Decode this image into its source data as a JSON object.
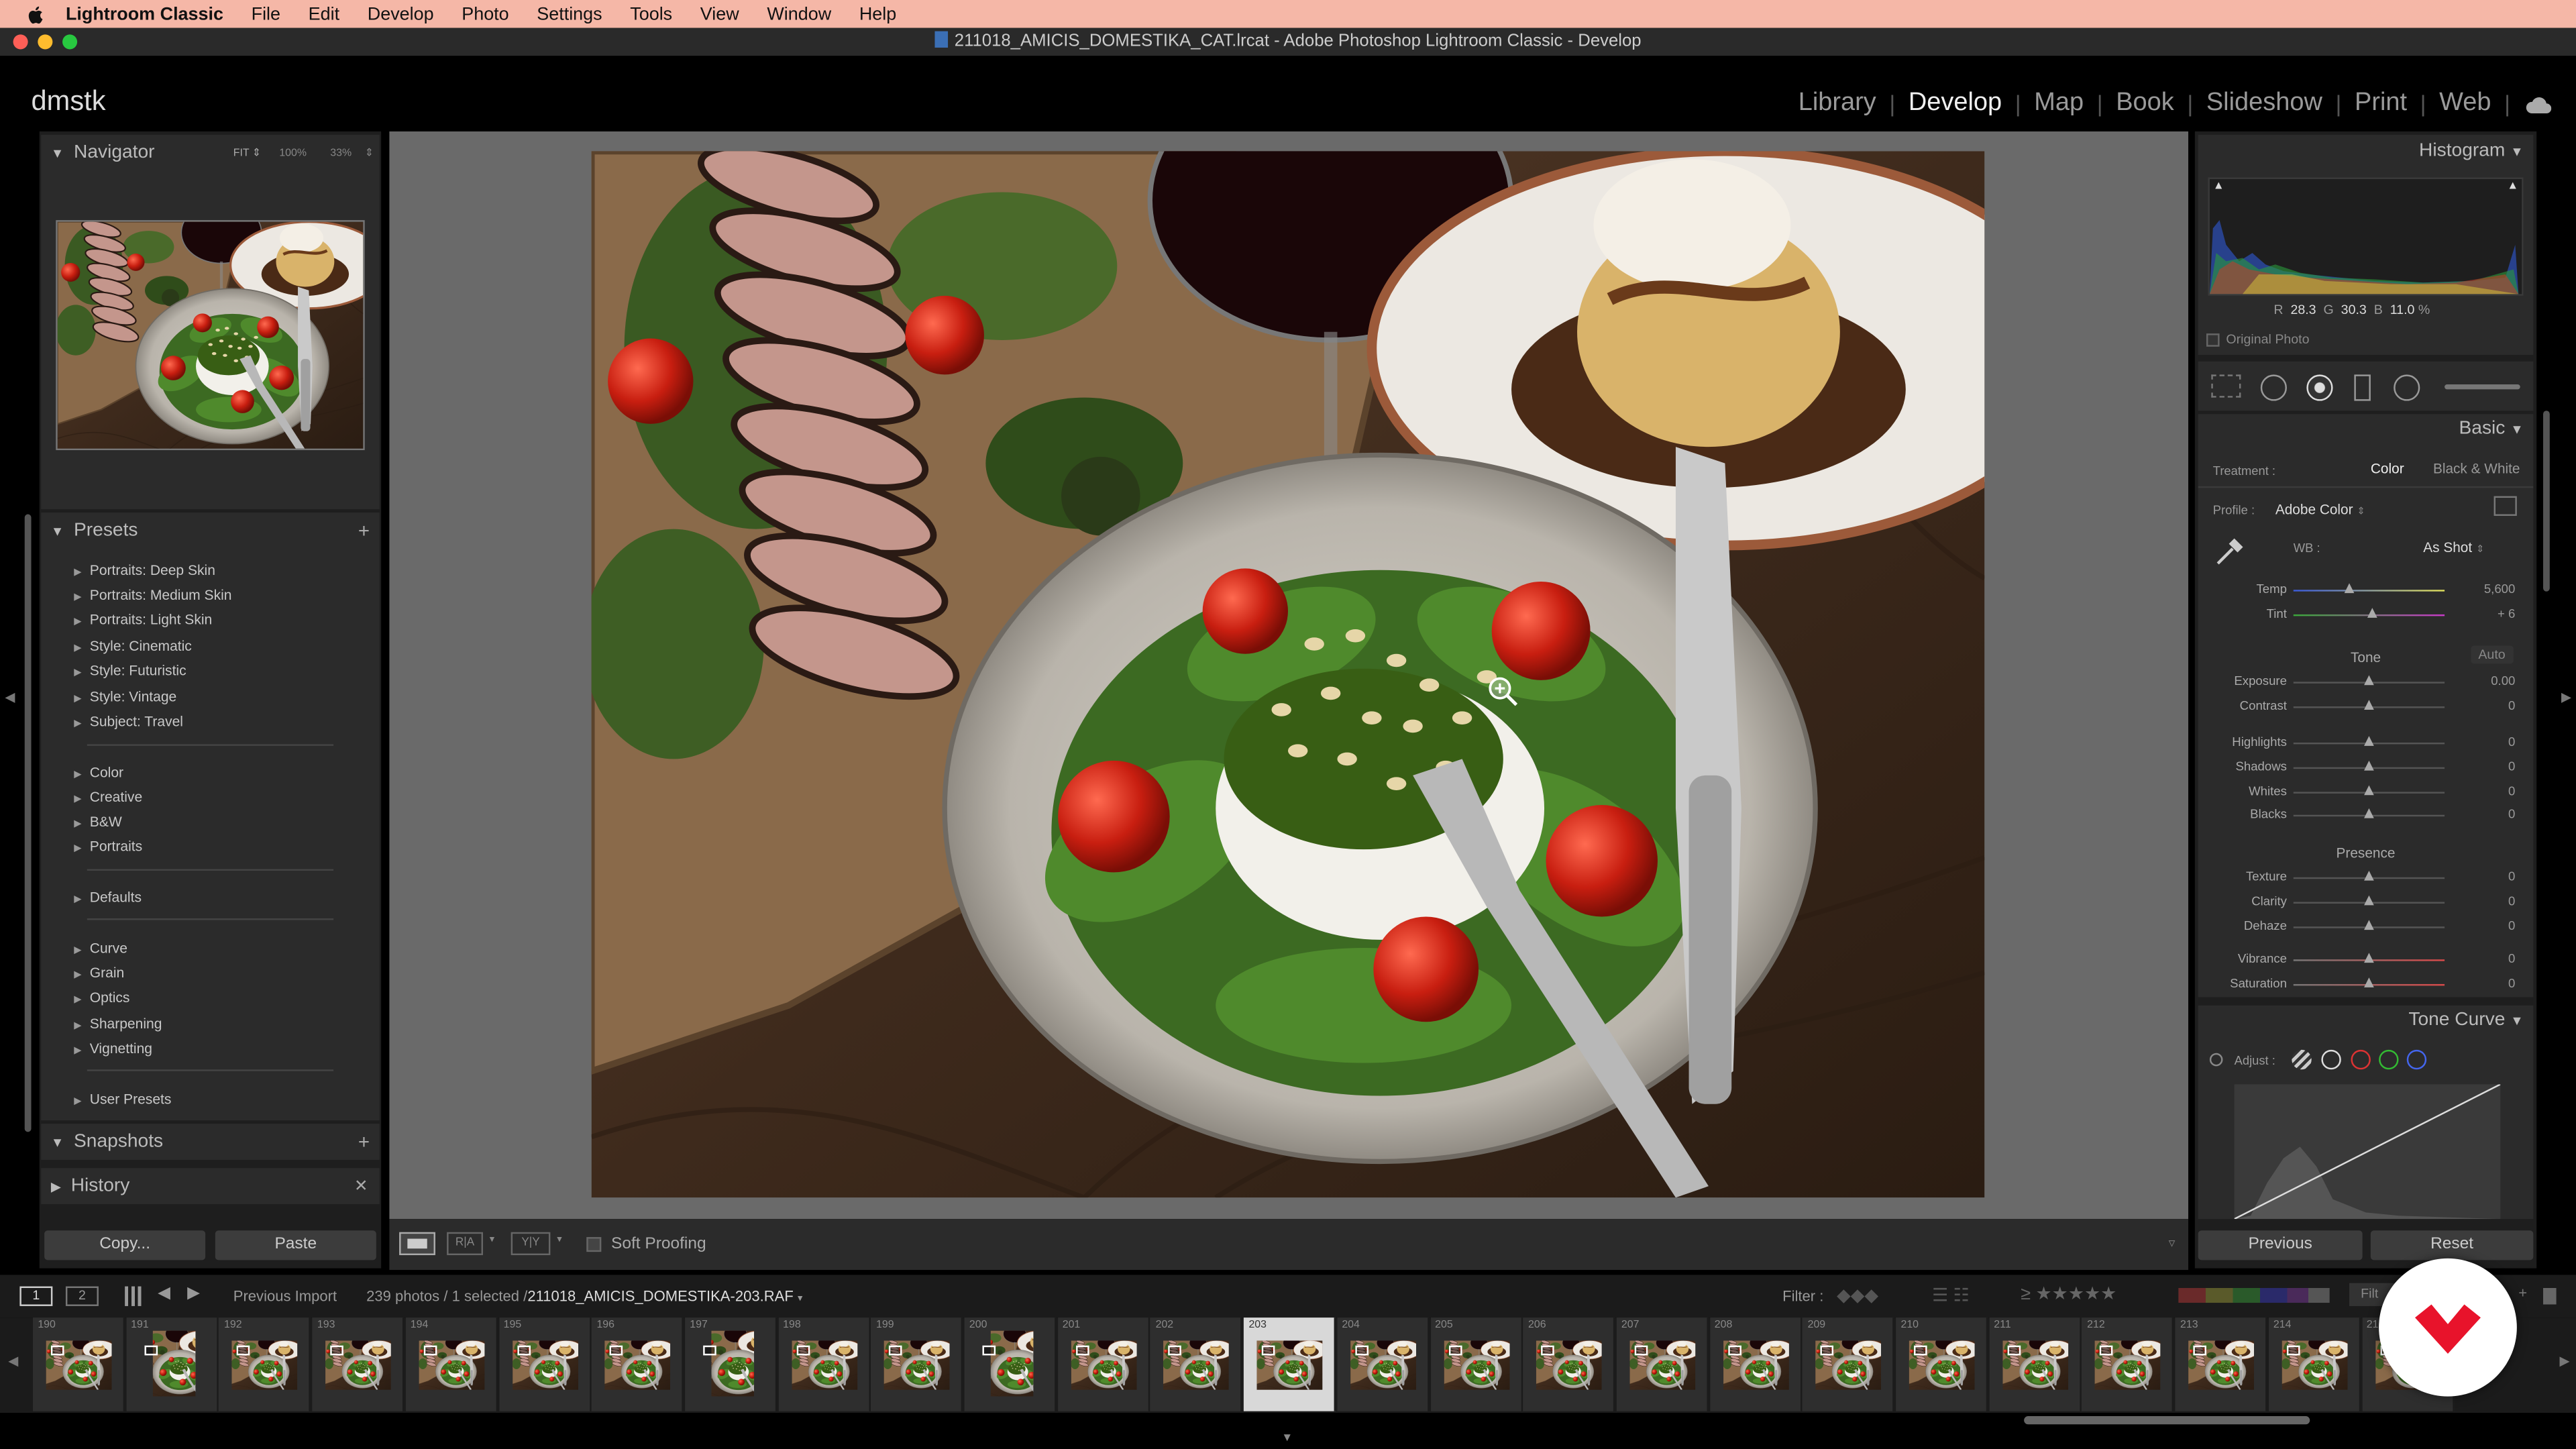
{
  "menubar": {
    "app": "Lightroom Classic",
    "items": [
      "File",
      "Edit",
      "Develop",
      "Photo",
      "Settings",
      "Tools",
      "View",
      "Window",
      "Help"
    ]
  },
  "window": {
    "title": "211018_AMICIS_DOMESTIKA_CAT.lrcat - Adobe Photoshop Lightroom Classic - Develop"
  },
  "identity_plate": "dmstk",
  "modules": [
    "Library",
    "Develop",
    "Map",
    "Book",
    "Slideshow",
    "Print",
    "Web"
  ],
  "active_module": "Develop",
  "navigator": {
    "title": "Navigator",
    "zoom_fit": "FIT",
    "zoom_100": "100%",
    "zoom_33": "33%"
  },
  "presets": {
    "title": "Presets",
    "items": [
      "Portraits: Deep Skin",
      "Portraits: Medium Skin",
      "Portraits: Light Skin",
      "Style: Cinematic",
      "Style: Futuristic",
      "Style: Vintage",
      "Subject: Travel",
      "Color",
      "Creative",
      "B&W",
      "Portraits",
      "Defaults",
      "Curve",
      "Grain",
      "Optics",
      "Sharpening",
      "Vignetting",
      "User Presets"
    ]
  },
  "snapshots": {
    "title": "Snapshots"
  },
  "history": {
    "title": "History"
  },
  "left_buttons": {
    "copy": "Copy...",
    "paste": "Paste"
  },
  "toolbar": {
    "soft_proofing": "Soft Proofing"
  },
  "histogram": {
    "title": "Histogram",
    "r_label": "R",
    "r": "28.3",
    "g_label": "G",
    "g": "30.3",
    "b_label": "B",
    "b": "11.0",
    "pct": "%",
    "original_photo": "Original Photo"
  },
  "basic": {
    "title": "Basic",
    "treatment_label": "Treatment :",
    "treatment_color": "Color",
    "treatment_bw": "Black & White",
    "profile_label": "Profile :",
    "profile_value": "Adobe Color",
    "wb_label": "WB :",
    "wb_value": "As Shot",
    "tone_label": "Tone",
    "auto_label": "Auto",
    "presence_label": "Presence",
    "sliders": [
      {
        "label": "Temp",
        "value": "5,600",
        "pos": 0.37
      },
      {
        "label": "Tint",
        "value": "+ 6",
        "pos": 0.52
      },
      {
        "label": "Exposure",
        "value": "0.00",
        "pos": 0.5
      },
      {
        "label": "Contrast",
        "value": "0",
        "pos": 0.5
      },
      {
        "label": "Highlights",
        "value": "0",
        "pos": 0.5
      },
      {
        "label": "Shadows",
        "value": "0",
        "pos": 0.5
      },
      {
        "label": "Whites",
        "value": "0",
        "pos": 0.5
      },
      {
        "label": "Blacks",
        "value": "0",
        "pos": 0.5
      },
      {
        "label": "Texture",
        "value": "0",
        "pos": 0.5
      },
      {
        "label": "Clarity",
        "value": "0",
        "pos": 0.5
      },
      {
        "label": "Dehaze",
        "value": "0",
        "pos": 0.5
      },
      {
        "label": "Vibrance",
        "value": "0",
        "pos": 0.5
      },
      {
        "label": "Saturation",
        "value": "0",
        "pos": 0.5
      }
    ]
  },
  "tone_curve": {
    "title": "Tone Curve",
    "adjust_label": "Adjust :"
  },
  "right_buttons": {
    "previous": "Previous",
    "reset": "Reset"
  },
  "filmstrip": {
    "source": "Previous Import",
    "count": "239 photos / 1 selected /",
    "file": "211018_AMICIS_DOMESTIKA-203.RAF",
    "filter_label": "Filter :",
    "filter_short": "Filt",
    "numbers": [
      "190",
      "191",
      "192",
      "193",
      "194",
      "195",
      "196",
      "197",
      "198",
      "199",
      "200",
      "201",
      "202",
      "203",
      "204",
      "205",
      "206",
      "207",
      "208",
      "209",
      "210",
      "211",
      "212",
      "213",
      "214",
      "215"
    ],
    "selected": "203"
  },
  "colors": {
    "menubar": "#f5b7a7",
    "panel": "#2b2b2b",
    "center_bg": "#6a6a6a",
    "domestika_red": "#e8132b"
  }
}
